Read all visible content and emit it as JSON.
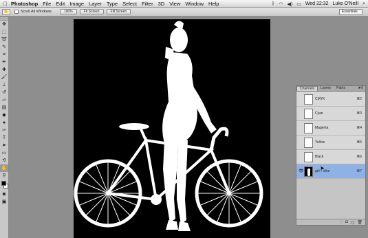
{
  "menubar": {
    "apple_icon": "apple-logo-icon",
    "app_name": "Photoshop",
    "items": [
      "File",
      "Edit",
      "Image",
      "Layer",
      "Type",
      "Select",
      "Filter",
      "3D",
      "View",
      "Window",
      "Help"
    ],
    "clock": "Wed 22:32",
    "user": "Luke O'Neill",
    "status_icons": [
      "bluetooth-icon",
      "wifi-icon",
      "volume-icon",
      "battery-icon"
    ]
  },
  "options": {
    "scroll_all_windows": "Scroll All Windows",
    "actual_pixels": "100%",
    "fit_screen": "Fit Screen",
    "fill_screen": "Fill Screen",
    "workspace": "Essentials"
  },
  "channels_panel": {
    "tabs": [
      "Channels",
      "Layers",
      "Paths"
    ],
    "active_tab": "Channels",
    "channels": [
      {
        "name": "CMYK",
        "shortcut": "⌘2",
        "visible": false,
        "thumb": "light",
        "active": false
      },
      {
        "name": "Cyan",
        "shortcut": "⌘3",
        "visible": false,
        "thumb": "light",
        "active": false
      },
      {
        "name": "Magenta",
        "shortcut": "⌘4",
        "visible": false,
        "thumb": "light",
        "active": false
      },
      {
        "name": "Yellow",
        "shortcut": "⌘5",
        "visible": false,
        "thumb": "light",
        "active": false
      },
      {
        "name": "Black",
        "shortcut": "⌘6",
        "visible": false,
        "thumb": "light",
        "active": false
      },
      {
        "name": "girl + bike",
        "shortcut": "⌘7",
        "visible": true,
        "thumb": "dark",
        "active": true
      }
    ]
  },
  "colors": {
    "foreground": "#000000",
    "background": "#ffffff",
    "selection": "#8fb2e6"
  }
}
